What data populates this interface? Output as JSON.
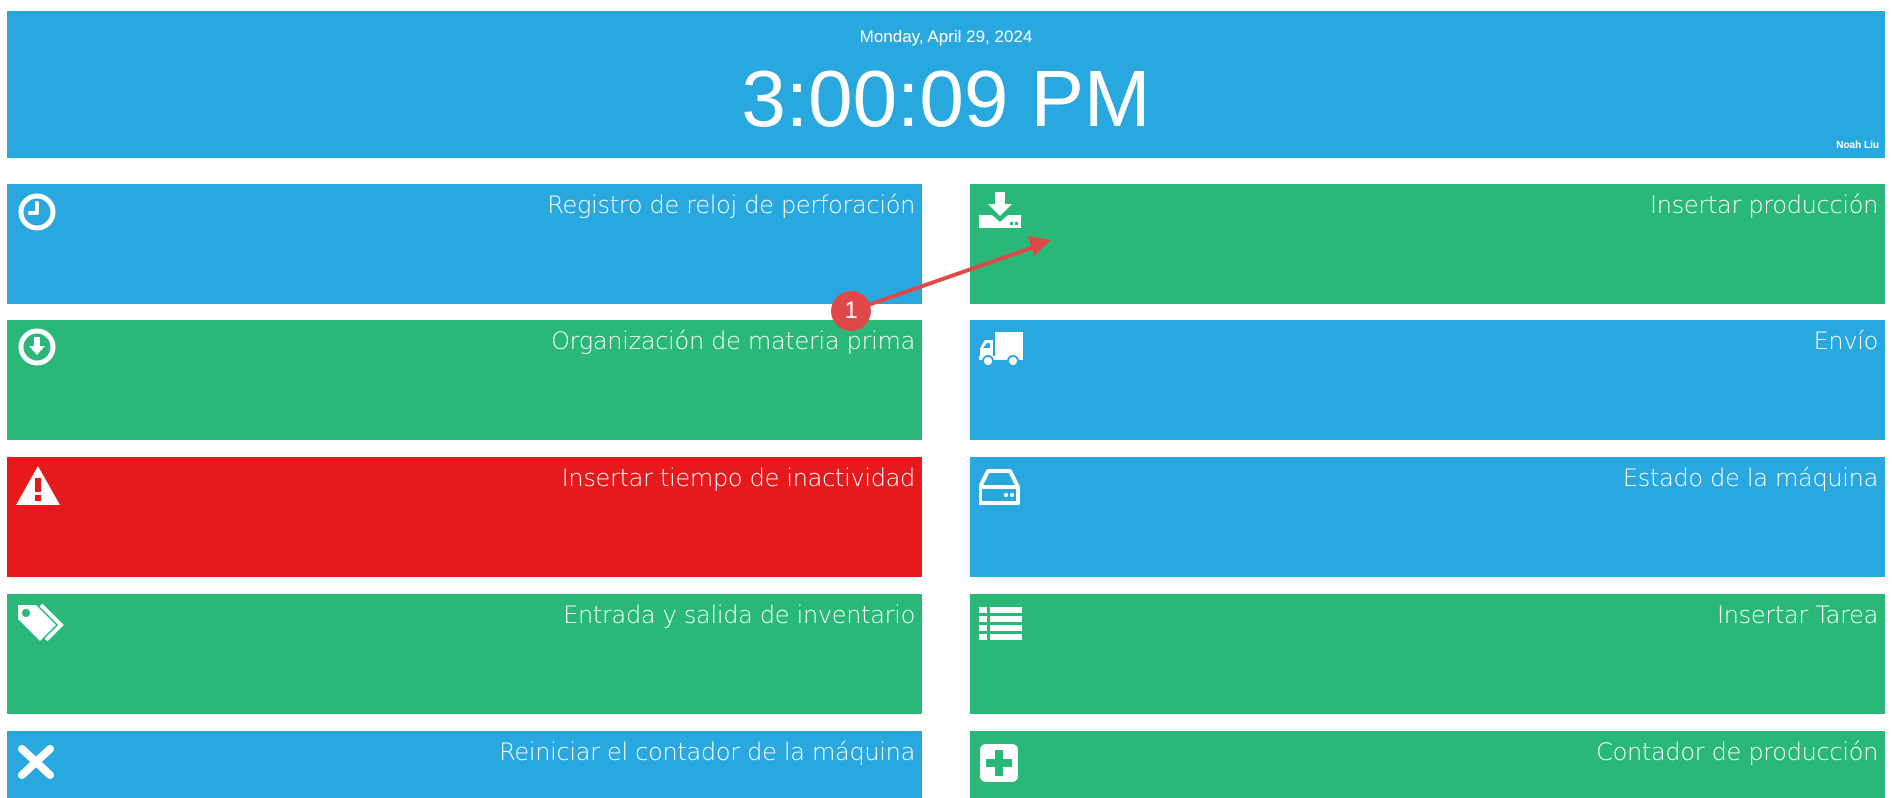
{
  "header": {
    "date": "Monday, April 29, 2024",
    "time": "3:00:09 PM",
    "user": "Noah Liu"
  },
  "colors": {
    "blue": "#29a8e0",
    "green": "#29b877",
    "red": "#e8191d",
    "annotation": "#e04848"
  },
  "tiles_left": [
    {
      "label": "Registro de reloj de perforación",
      "icon": "clock-icon",
      "color": "blue"
    },
    {
      "label": "Organización de materia prima",
      "icon": "download-circle-icon",
      "color": "green"
    },
    {
      "label": "Insertar tiempo de inactividad",
      "icon": "warning-icon",
      "color": "red"
    },
    {
      "label": "Entrada y salida de inventario",
      "icon": "tags-icon",
      "color": "green"
    },
    {
      "label": "Reiniciar el contador de la máquina",
      "icon": "close-icon",
      "color": "blue"
    }
  ],
  "tiles_right": [
    {
      "label": "Insertar producción",
      "icon": "download-tray-icon",
      "color": "green"
    },
    {
      "label": "Envío",
      "icon": "truck-icon",
      "color": "blue"
    },
    {
      "label": "Estado de la máquina",
      "icon": "hard-drive-icon",
      "color": "blue"
    },
    {
      "label": "Insertar Tarea",
      "icon": "list-icon",
      "color": "green"
    },
    {
      "label": "Contador de producción",
      "icon": "plus-square-icon",
      "color": "green"
    }
  ],
  "annotation": {
    "badge": "1"
  }
}
